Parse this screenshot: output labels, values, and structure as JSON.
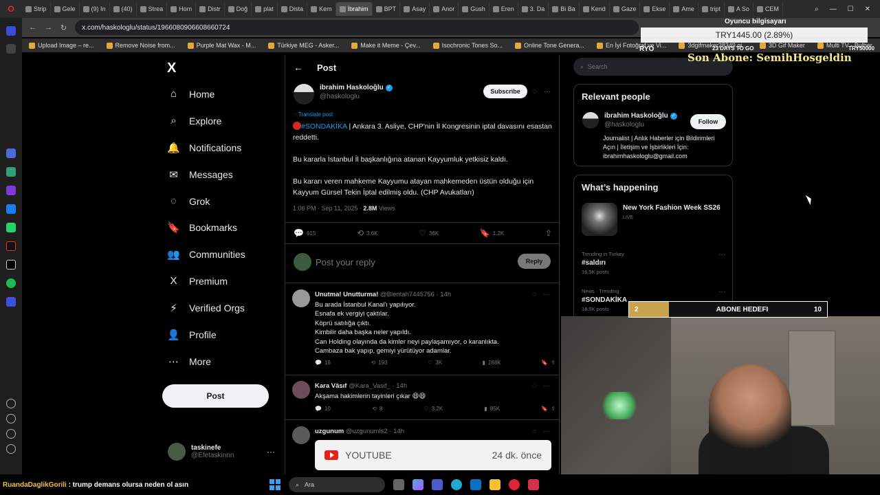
{
  "browser": {
    "tabs": [
      "Strip",
      "Gele",
      "(9) In",
      "(40)",
      "Strea",
      "Hom",
      "Distr",
      "Doğ",
      "plat",
      "Dista",
      "Kem",
      "İbrahim",
      "BPT",
      "Asay",
      "Anor",
      "Gush",
      "Eren",
      "3. Da",
      "Bi Ba",
      "Kend",
      "Gaze",
      "Ekse",
      "Ame",
      "tript",
      "A So",
      "CEM"
    ],
    "active_tab_index": 11,
    "url": "x.com/haskologlu/status/1966080906608660724",
    "bookmarks": [
      "Upload Image – re...",
      "Remove Noise from...",
      "Purple Mat Wax - M...",
      "Türkiye MEG - Asker...",
      "Make it Meme - Çev...",
      "Isochronic Tones So...",
      "Online Tone Genera...",
      "En İyi Fotoğraf ve Vi...",
      "3dgifmaker28349.gi...",
      "3D Gif Maker",
      "Multi TV - Bulber",
      "Rehber: Windows 1..."
    ]
  },
  "nav": {
    "logo": "X",
    "items": [
      {
        "label": "Home",
        "icon": "⌂"
      },
      {
        "label": "Explore",
        "icon": "⌕"
      },
      {
        "label": "Notifications",
        "icon": "🔔"
      },
      {
        "label": "Messages",
        "icon": "✉"
      },
      {
        "label": "Grok",
        "icon": "◌"
      },
      {
        "label": "Bookmarks",
        "icon": "🔖"
      },
      {
        "label": "Communities",
        "icon": "👥"
      },
      {
        "label": "Premium",
        "icon": "X"
      },
      {
        "label": "Verified Orgs",
        "icon": "⚡"
      },
      {
        "label": "Profile",
        "icon": "👤"
      },
      {
        "label": "More",
        "icon": "⋯"
      }
    ],
    "post_label": "Post",
    "me": {
      "name": "taskinefe",
      "handle": "@Efetaskinnn",
      "more": "···"
    }
  },
  "main": {
    "header": "Post",
    "tweet": {
      "author": "ibrahim Haskoloğlu",
      "handle": "@haskologlu",
      "subscribe": "Subscribe",
      "translate": "Translate post",
      "hashtag": "#SONDAKİKA",
      "p1": " | Ankara 3. Asliye, CHP'nin İl Kongresinin iptal davasını esastan reddetti.",
      "p2": "Bu kararla İstanbul İl başkanlığına atanan Kayyumluk yetkisiz kaldı.",
      "p3": "Bu kararı veren mahkeme Kayyumu atayan mahkemeden üstün olduğu için Kayyum Gürsel Tekin  İptal edilmiş oldu. (CHP Avukatları)",
      "time": "1:06 PM · Sep 11, 2025 · ",
      "views": "2.8M",
      "views_label": " Views",
      "replies": "615",
      "reposts": "3.6K",
      "likes": "36K",
      "bookmarks": "1.2K"
    },
    "reply_placeholder": "Post your reply",
    "reply_button": "Reply",
    "replies": [
      {
        "name": "Unutma! Unutturma!",
        "handle": "@Blentah7445756 · 14h",
        "lines": [
          "Bu arada İstanbul Kanal'ı yapılıyor.",
          "Esnafa ek vergiyi çaktılar.",
          "Köprü satılığa çıktı.",
          "Kimbilir daha başka neler yapıldı.",
          "Can Holding olayında da kimler neyi paylaşamıyor, o karanlıkta.",
          "Cambaza bak yapıp, gemiyi yürütüyor adamlar."
        ],
        "replies": "16",
        "reposts": "193",
        "likes": "3K",
        "views": "168K"
      },
      {
        "name": "Kara Vâsıf",
        "handle": "@Kara_Vasif_ · 14h",
        "lines": [
          "Akşama hakimlerin tayinleri çıkar 😄😄"
        ],
        "replies": "10",
        "reposts": "8",
        "likes": "3.2K",
        "views": "85K"
      },
      {
        "name": "uzgunum",
        "handle": "@uzgunumls2 · 14h",
        "card_label": "YOUTUBE",
        "card_time": "24 dk. önce"
      }
    ]
  },
  "right": {
    "search_placeholder": "Search",
    "relevant_title": "Relevant people",
    "person": {
      "name": "ibrahim Haskoloğlu",
      "handle": "@haskologlu",
      "follow": "Follow",
      "bio": "Journalist | Anlık Haberler için Bildirimleri Açın | İletişim ve İşbirlikleri İçin: ibrahimhaskologlu@gmail.com"
    },
    "happening_title": "What’s happening",
    "event": {
      "title": "New York Fashion Week SS26",
      "status": "LIVE"
    },
    "trends": [
      {
        "context": "Trending in Turkey",
        "tag": "#saldırı",
        "posts": "16.5K posts"
      },
      {
        "context": "News · Trending",
        "tag": "#SONDAKİKA",
        "posts": "18.5K posts"
      }
    ]
  },
  "overlay": {
    "title": "Oyuncu bilgisayarı",
    "price": "TRY1445.00 (2.89%)",
    "left_tag": "RYO",
    "days": "23 DAYS TO GO",
    "try_target": "TRY50000",
    "last_sub": "Son Abone: SemihHosgeldin",
    "goal_current": "2",
    "goal_label": "ABONE HEDEFI",
    "goal_target": "10",
    "goal_progress": 0.2
  },
  "chat": {
    "user": "RuandaDaglikGorili",
    "message": " : trump demans olursa neden ol asın"
  },
  "taskbar": {
    "search": "Ara"
  }
}
